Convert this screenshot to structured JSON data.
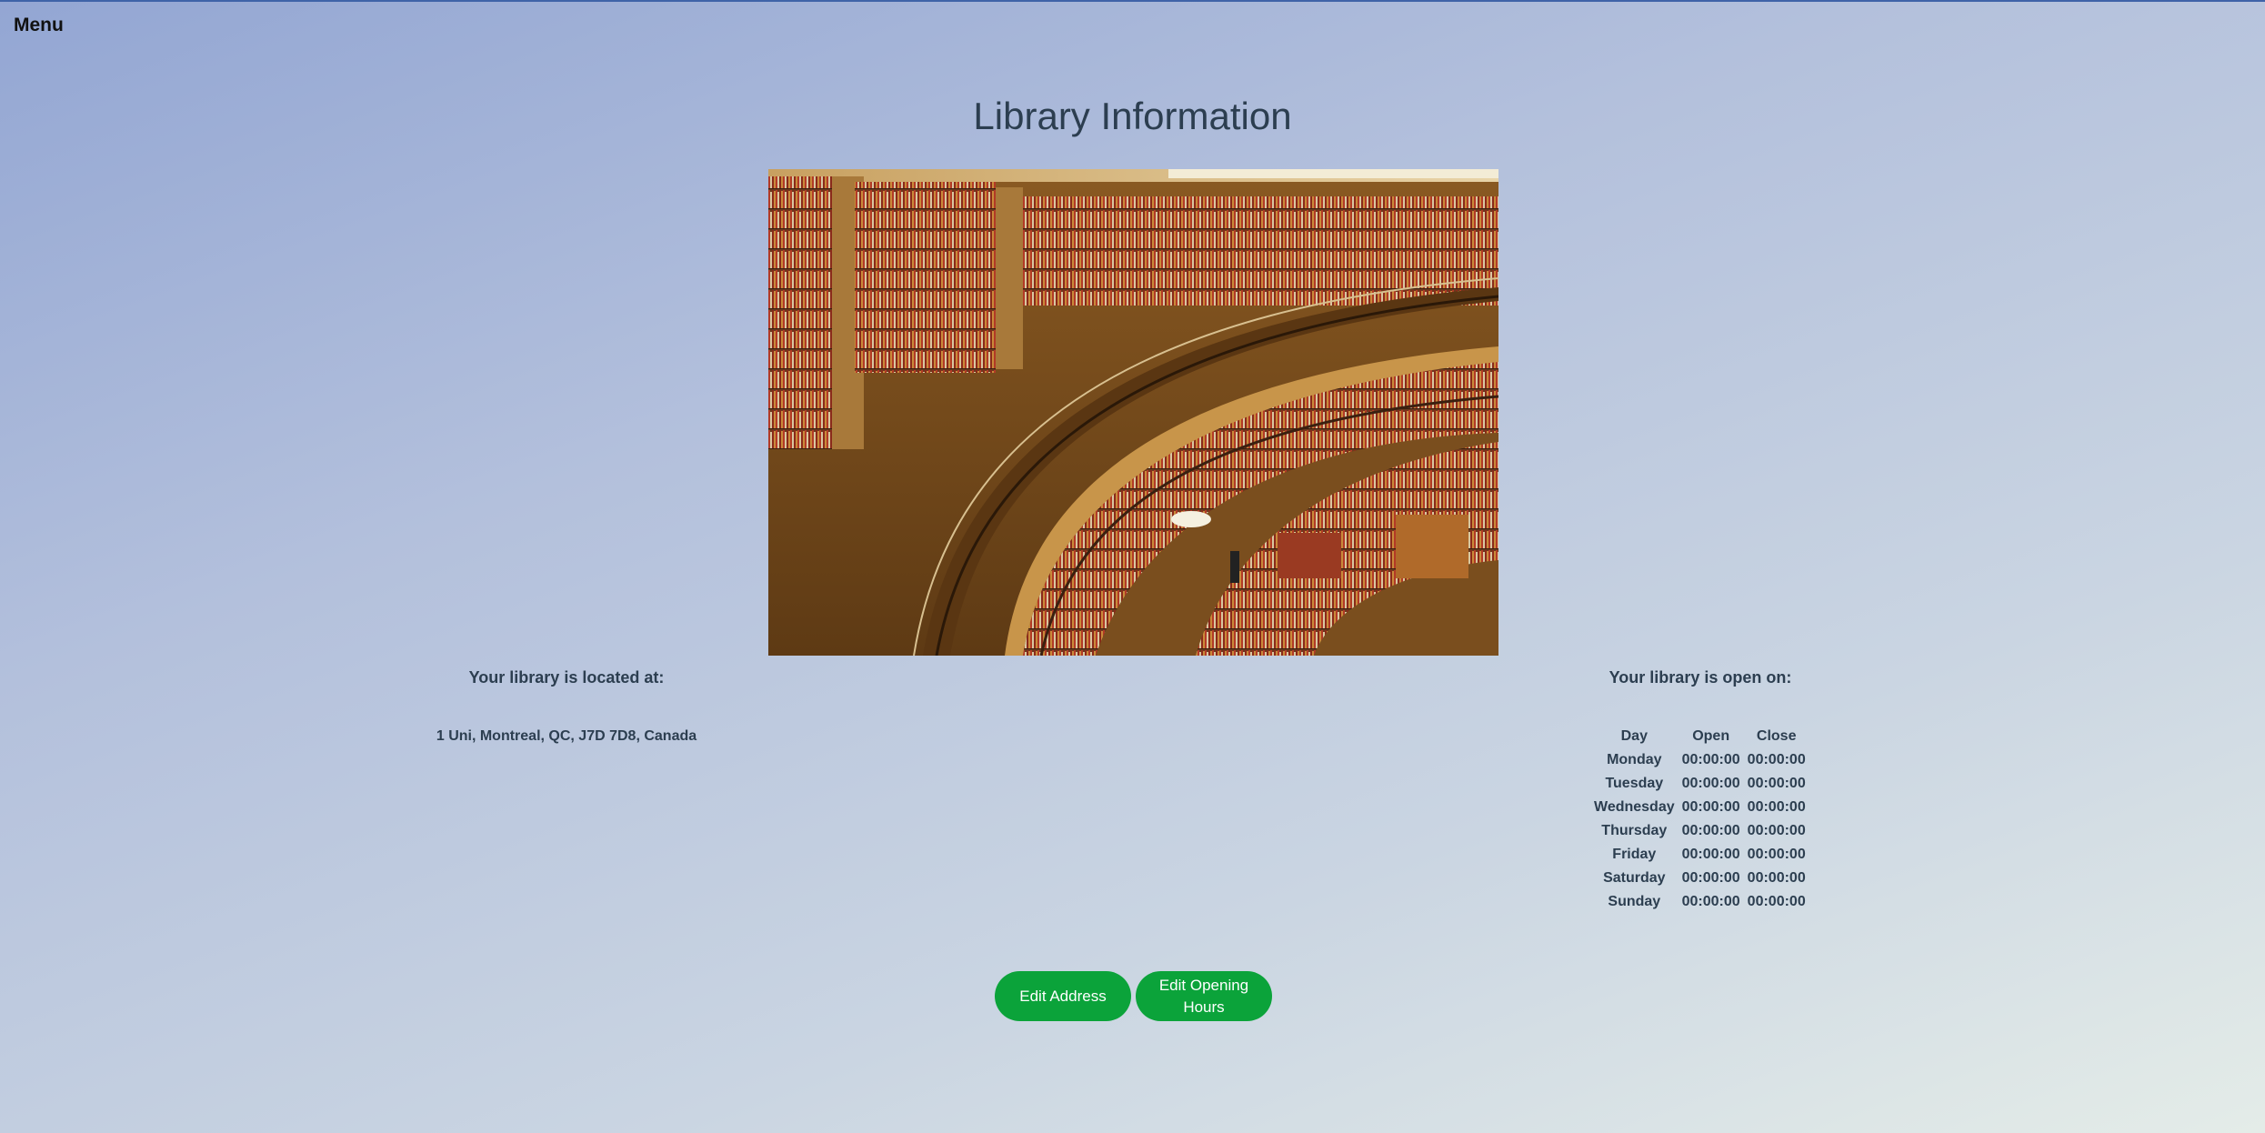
{
  "menu": {
    "label": "Menu"
  },
  "page": {
    "title": "Library Information"
  },
  "address": {
    "heading": "Your library is located at:",
    "text": "1 Uni, Montreal, QC, J7D 7D8, Canada"
  },
  "hours": {
    "heading": "Your library is open on:",
    "columns": [
      "Day",
      "Open",
      "Close"
    ],
    "rows": [
      {
        "day": "Monday",
        "open": "00:00:00",
        "close": "00:00:00"
      },
      {
        "day": "Tuesday",
        "open": "00:00:00",
        "close": "00:00:00"
      },
      {
        "day": "Wednesday",
        "open": "00:00:00",
        "close": "00:00:00"
      },
      {
        "day": "Thursday",
        "open": "00:00:00",
        "close": "00:00:00"
      },
      {
        "day": "Friday",
        "open": "00:00:00",
        "close": "00:00:00"
      },
      {
        "day": "Saturday",
        "open": "00:00:00",
        "close": "00:00:00"
      },
      {
        "day": "Sunday",
        "open": "00:00:00",
        "close": "00:00:00"
      }
    ]
  },
  "buttons": {
    "edit_address": "Edit Address",
    "edit_hours": "Edit Opening Hours"
  },
  "colors": {
    "button": "#0ba33a",
    "text": "#2c3e50",
    "accent_line": "#3f63a8"
  },
  "image": {
    "subject": "library-interior-photo"
  }
}
